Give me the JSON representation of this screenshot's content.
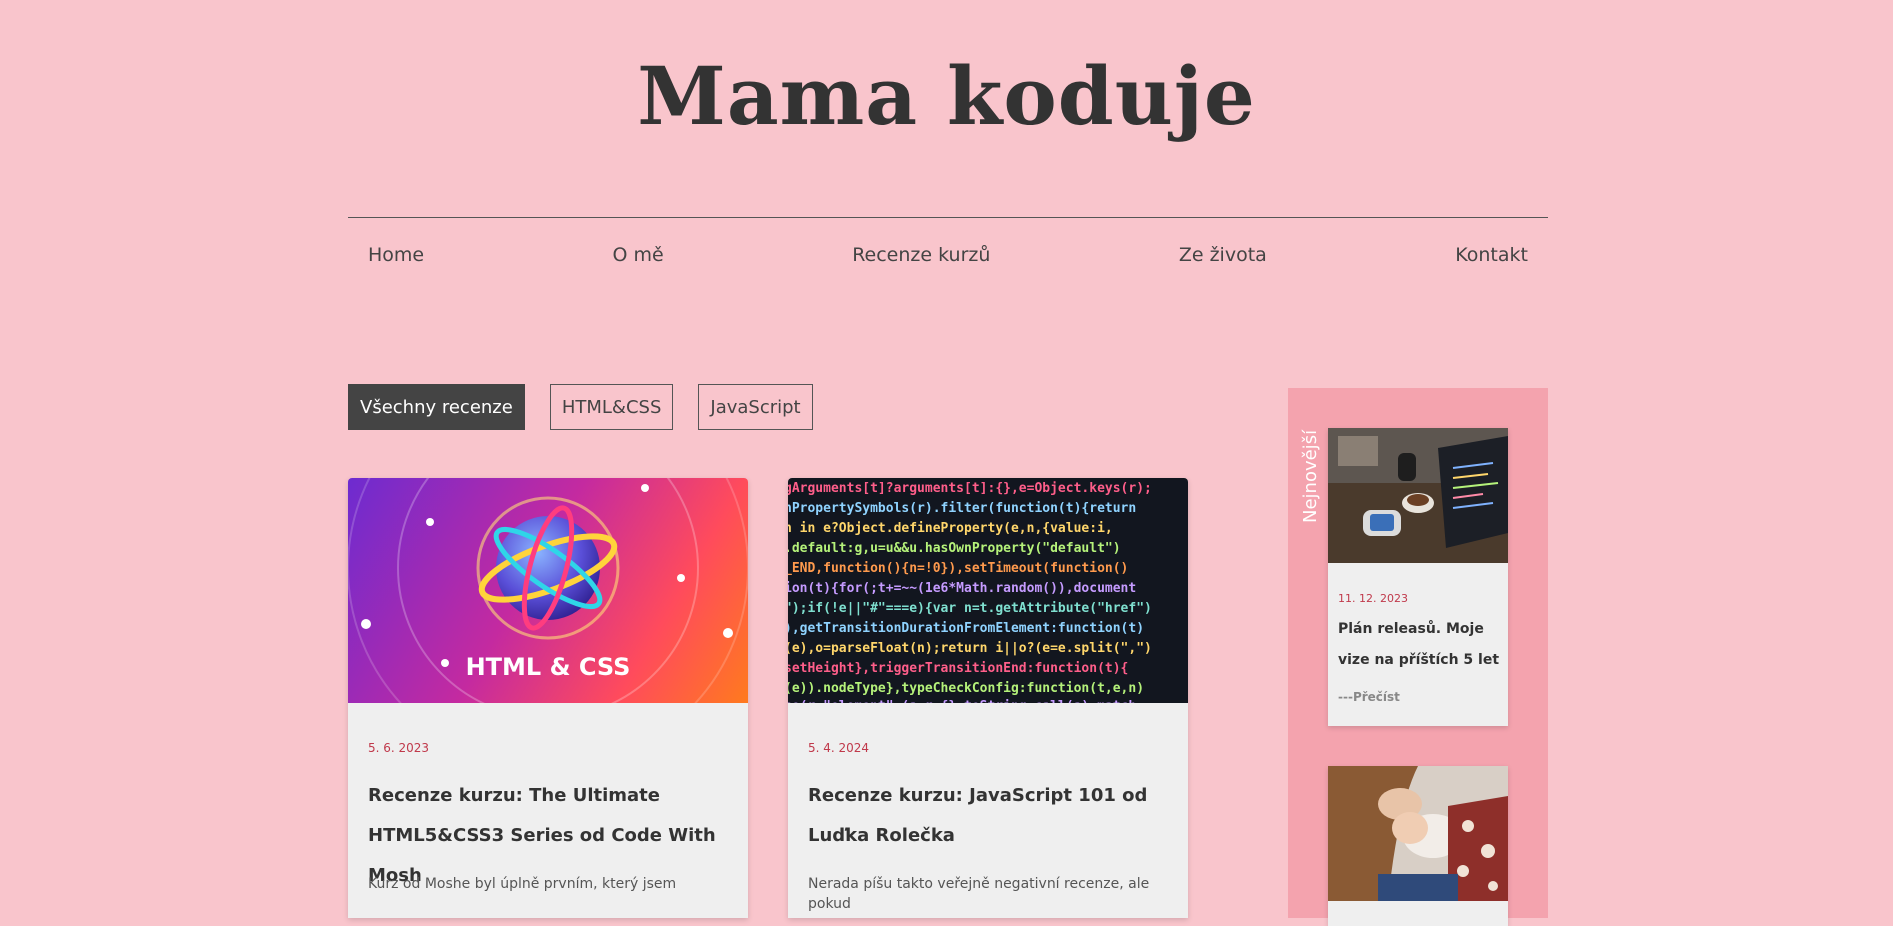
{
  "site": {
    "title": "Mama koduje"
  },
  "nav": {
    "items": [
      {
        "label": "Home"
      },
      {
        "label": "O mě"
      },
      {
        "label": "Recenze kurzů"
      },
      {
        "label": "Ze života"
      },
      {
        "label": "Kontakt"
      }
    ]
  },
  "filters": {
    "items": [
      {
        "label": "Všechny recenze",
        "active": true
      },
      {
        "label": "HTML&CSS",
        "active": false
      },
      {
        "label": "JavaScript",
        "active": false
      }
    ]
  },
  "posts": [
    {
      "image_text": "HTML & CSS",
      "image_icon": "atom-globe-icon",
      "date": "5. 6. 2023",
      "title": "Recenze kurzu: The Ultimate HTML5&CSS3 Series od Code With Mosh",
      "excerpt": "Kurz od Moshe byl úplně prvním, který jsem"
    },
    {
      "image_icon": "code-screen-image",
      "date": "5. 4. 2024",
      "title": "Recenze kurzu: JavaScript 101 od Luďka Rolečka",
      "excerpt": "Nerada píšu takto veřejně negativní recenze, ale pokud"
    }
  ],
  "sidebar": {
    "label": "Nejnovější",
    "posts": [
      {
        "image_icon": "laptop-desk-photo",
        "date": "11. 12. 2023",
        "title": "Plán releasů. Moje vize na příštích 5 let",
        "read_more": "---Přečíst"
      },
      {
        "image_icon": "baby-photo"
      }
    ]
  },
  "colors": {
    "background": "#f9c5cc",
    "sidebar": "#f4a3ae",
    "accent_date": "#c0394b",
    "active_filter": "#444444"
  }
}
